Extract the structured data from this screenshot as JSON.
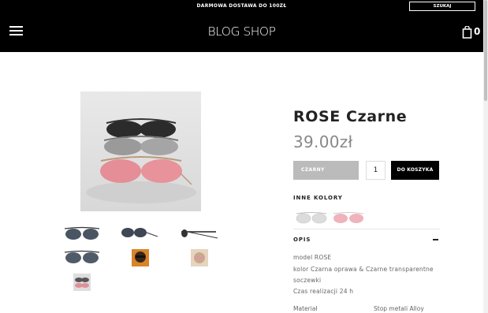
{
  "header": {
    "promo": "DARMOWA DOSTAWA DO 100ZŁ",
    "search_label": "SZUKAJ",
    "logo": "BLOG SHOP",
    "cart_count": "0",
    "menu_icon": "hamburger-menu-icon",
    "cart_icon": "shopping-bag-icon"
  },
  "product": {
    "title": "ROSE Czarne",
    "price": "39.00zł",
    "color_option": "CZARNY",
    "quantity": "1",
    "add_to_cart": "DO KOSZYKA",
    "other_colors_label": "INNE KOLORY",
    "description_label": "OPIS",
    "description_lines": [
      "model ROSE",
      "kolor Czarna oprawa & Czarne transparentne",
      "soczewki",
      "Czas realizacji 24 h"
    ],
    "spec": {
      "label": "Materiał",
      "value": "Stop metali Alloy"
    }
  },
  "colors": {
    "header_bg": "#000000",
    "accent": "#000000",
    "price": "#888888",
    "selected_color_bg": "#bbbbbb"
  }
}
